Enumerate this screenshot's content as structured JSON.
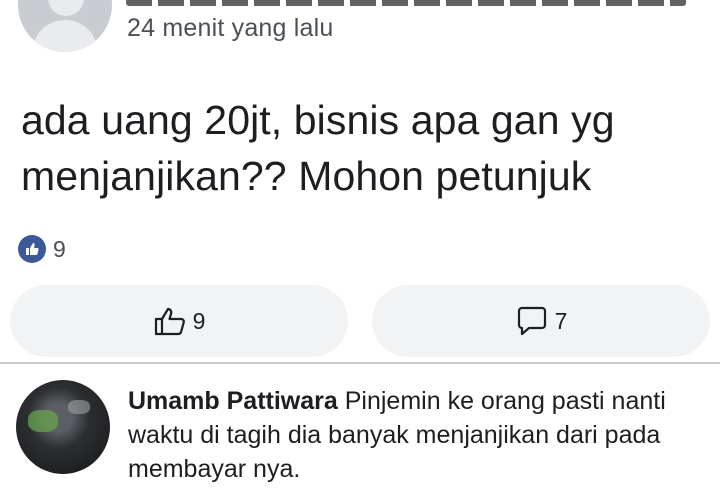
{
  "post": {
    "timestamp": "24 menit yang lalu",
    "text": "ada uang 20jt, bisnis apa gan yg menjanjikan?? Mohon petunjuk",
    "reaction_count": "9"
  },
  "actions": {
    "like_count": "9",
    "comment_count": "7"
  },
  "comment": {
    "author": "Umamb Pattiwara",
    "text": "Pinjemin ke orang pasti nanti waktu di tagih dia banyak menjanjikan dari pada membayar nya."
  },
  "colors": {
    "like_badge": "#3b5998",
    "button_bg": "#f2f3f5",
    "text": "#1c1e21",
    "muted": "#4b4f56"
  }
}
